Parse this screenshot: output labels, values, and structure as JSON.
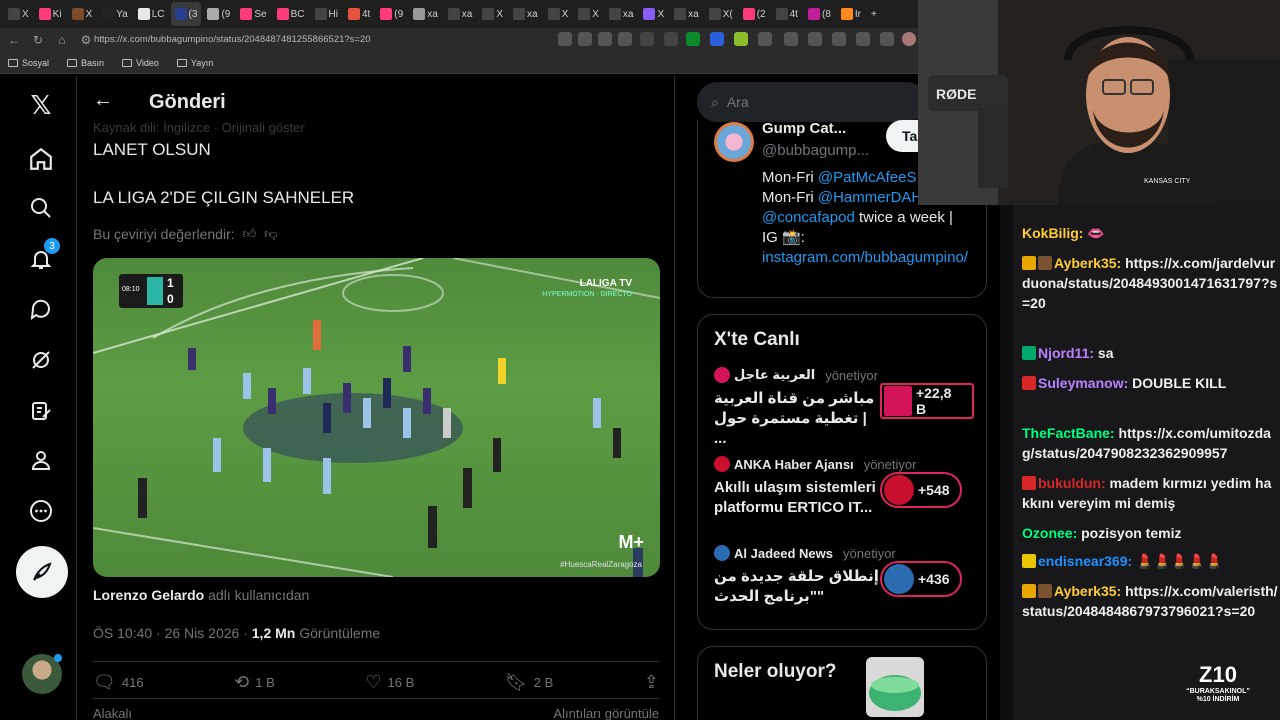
{
  "browser": {
    "tabs": [
      "X",
      "Ki",
      "X",
      "Ya",
      "LC",
      "(3",
      "(9",
      "Se",
      "BC",
      "Hi",
      "4t",
      "(9",
      "xa",
      "xa",
      "X",
      "xa",
      "X",
      "X",
      "xa",
      "X",
      "xa",
      "X(",
      "(2",
      "4t",
      "(8",
      "Ir"
    ],
    "url": "https://x.com/bubbagumpino/status/2048487481255866521?s=20",
    "bookmarks": [
      "Sosyal",
      "Basın",
      "Video",
      "Yayın"
    ]
  },
  "leftnav": {
    "notif_count": "3"
  },
  "post": {
    "header_title": "Gönderi",
    "translated_note": "Kaynak dili: İngilizce · Orijinali göster",
    "line1": "LANET OLSUN",
    "line2": "LA LIGA 2'DE ÇILGIN SAHNELER",
    "rate_translation": "Bu çeviriyi değerlendir:",
    "video": {
      "score_home": "1",
      "score_away": "0",
      "clock": "08:10",
      "broadcaster": "LALIGA TV",
      "broadcaster_sub": "HYPERMOTION · DIRECTO",
      "provider": "M+",
      "hashtag": "#HuescaRealZaragoza"
    },
    "byline_name": "Lorenzo Gelardo",
    "byline_suffix": "adlı kullanıcıdan",
    "time": "ÖS 10:40 · 26 Nis 2026 · ",
    "views_count": "1,2 Mn",
    "views_label": "Görüntüleme",
    "replies": "416",
    "reposts": "1 B",
    "likes": "16 B",
    "bookmarks": "2 B",
    "bottom_left": "Alakalı",
    "bottom_right": "Alıntıları görüntüle"
  },
  "right": {
    "search_placeholder": "Ara",
    "profile": {
      "name": "Gump Cat...",
      "handle": "@bubbagump...",
      "follow": "Tak",
      "bio_1": "Mon-Fri ",
      "bio_link1": "@PatMcAfeeS",
      "bio_2": "Mon-Fri ",
      "bio_link2": "@HammerDAH",
      "bio_link3": "@concafapod",
      "bio_3": " twice a week |",
      "bio_4": "IG 📸:",
      "bio_link4": "instagram.com/bubbagumpino/"
    },
    "live_title": "X'te Canlı",
    "live": [
      {
        "host": "العربية عاجل",
        "managing": "yönetiyor",
        "title": "مباشر من قناة العربية | تغطية مستمرة حول ...",
        "count": "+22,8 B",
        "color": "#d4145a"
      },
      {
        "host": "ANKA Haber Ajansı",
        "managing": "yönetiyor",
        "title": "Akıllı ulaşım sistemleri platformu ERTICO IT...",
        "count": "+548",
        "color": "#c8102e"
      },
      {
        "host": "Al Jadeed News",
        "managing": "yönetiyor",
        "title": "إنطلاق حلقة جديدة من \"برنامج الحدث\"",
        "count": "+436",
        "color": "#2b6cb0"
      }
    ],
    "trends_title": "Neler oluyor?"
  },
  "chat": {
    "messages": [
      {
        "user": "KokBilig:",
        "text": " 👄",
        "color": "#ffcc33",
        "badges": []
      },
      {
        "user": "Ayberk35:",
        "text": " https://x.com/jardelvurduona/status/2048493001471631797?s=20",
        "color": "#ffcc33",
        "badges": [
          "#e8a600",
          "#7a5230"
        ]
      },
      {
        "user": "Njord11:",
        "text": " sa",
        "color": "#b983ff",
        "badges": [
          "#00a86b"
        ]
      },
      {
        "user": "Suleymanow:",
        "text": " DOUBLE KILL",
        "color": "#b983ff",
        "badges": [
          "#d62828"
        ]
      },
      {
        "user": "TheFactBane:",
        "text": " https://x.com/umitozdag/status/2047908232362909957",
        "color": "#00ff7f",
        "badges": []
      },
      {
        "user": "bukuldun:",
        "text": " madem kırmızı yedim hakkını vereyim mi demiş",
        "color": "#d62828",
        "badges": [
          "#d62828"
        ]
      },
      {
        "user": "Ozonee:",
        "text": " pozisyon temiz",
        "color": "#00ff7f",
        "badges": []
      },
      {
        "user": "endisnear369:",
        "text": " 💄💄💄💄💄",
        "color": "#1e90ff",
        "badges": [
          "#e8c700"
        ]
      },
      {
        "user": "Ayberk35:",
        "text": " https://x.com/valeristh/status/2048484867973796021?s=20",
        "color": "#ffcc33",
        "badges": [
          "#e8a600",
          "#7a5230"
        ]
      }
    ]
  },
  "promo": {
    "brand": "Z10",
    "line1": "“BURAKSAKINOL”",
    "line2": "%10 İNDİRİM"
  },
  "webcam": {
    "mic_brand": "RØDE",
    "shirt": "KANSAS CITY"
  }
}
